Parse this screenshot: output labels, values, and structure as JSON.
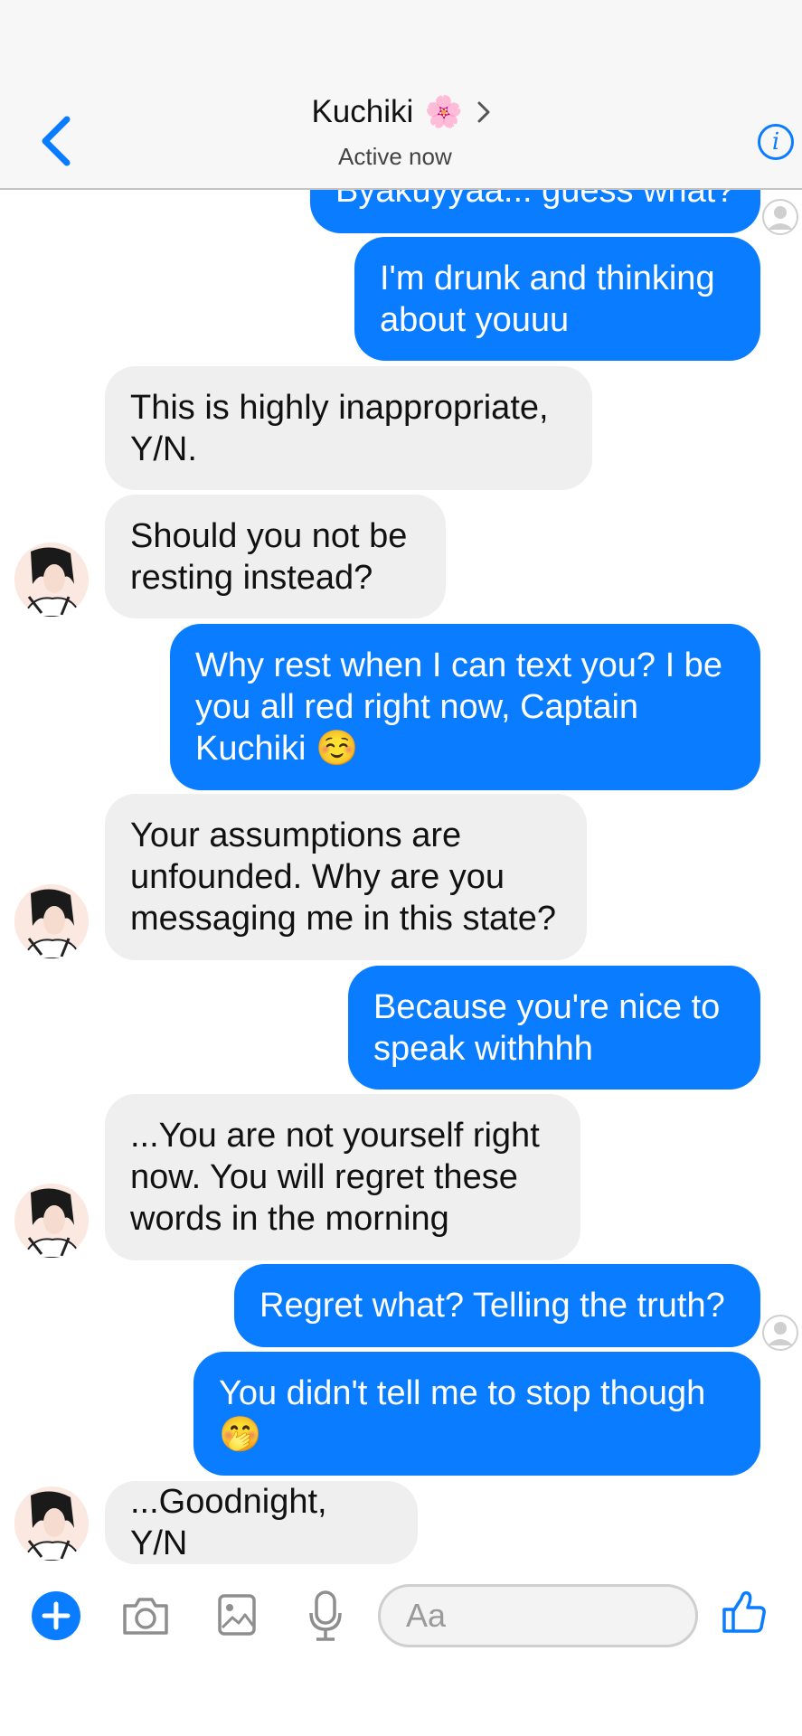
{
  "header": {
    "title": "Kuchiki",
    "title_emoji": "🌸",
    "status": "Active now"
  },
  "messages": [
    {
      "from": "me",
      "text": "Byakuyyaa... guess what?"
    },
    {
      "from": "me",
      "text": "I'm drunk and thinking about youuu"
    },
    {
      "from": "them",
      "text": "This is highly inappropriate, Y/N."
    },
    {
      "from": "them",
      "text": "Should you not be resting instead?"
    },
    {
      "from": "me",
      "text": "Why rest when I can text you? I be you all red right now, Captain Kuchiki ☺️"
    },
    {
      "from": "them",
      "text": "Your assumptions are unfounded. Why are you messaging me in this state?"
    },
    {
      "from": "me",
      "text": "Because you're nice to speak withhhh"
    },
    {
      "from": "them",
      "text": "...You are not yourself right now. You will regret these words in the morning"
    },
    {
      "from": "me",
      "text": "Regret what? Telling the truth?"
    },
    {
      "from": "me",
      "text": "You didn't tell me to stop though 🤭"
    },
    {
      "from": "them",
      "text": "...Goodnight, Y/N"
    }
  ],
  "composer": {
    "placeholder": "Aa"
  },
  "icons": {
    "back": "chevron-left-icon",
    "info": "info-icon",
    "plus": "plus-icon",
    "camera": "camera-icon",
    "gallery": "image-icon",
    "mic": "microphone-icon",
    "like": "thumbs-up-icon"
  },
  "colors": {
    "accent": "#0a7cff",
    "incoming_bubble": "#efefef",
    "outgoing_bubble": "#0a7cff"
  }
}
